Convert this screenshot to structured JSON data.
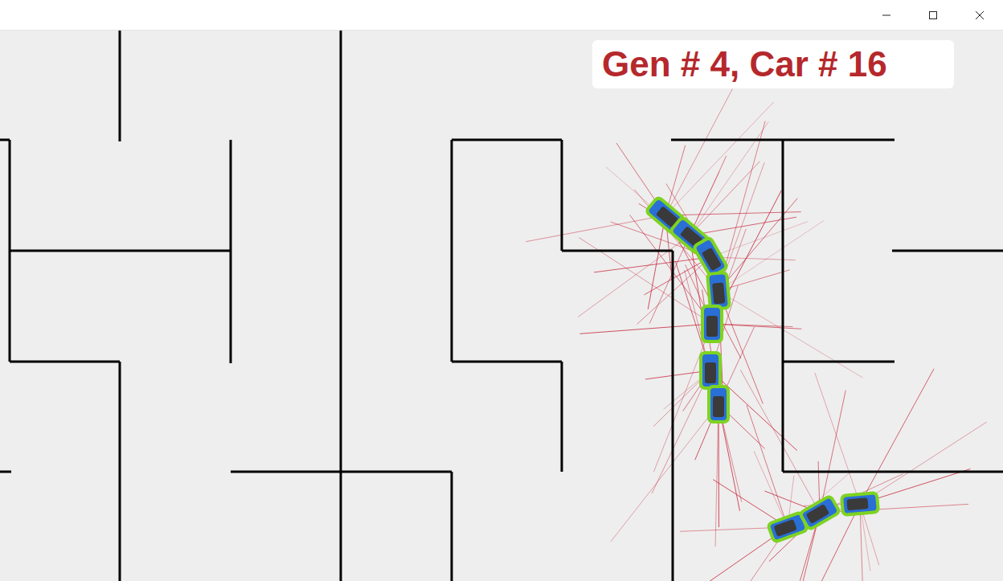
{
  "hud": {
    "label": "Gen # 4, Car # 16"
  }
}
